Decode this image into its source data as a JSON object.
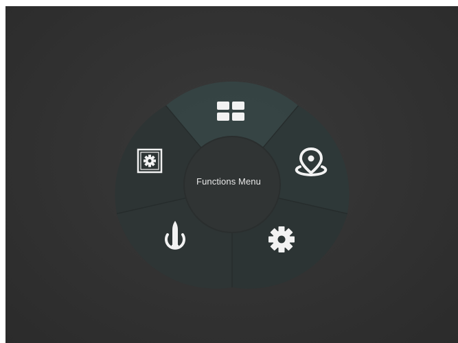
{
  "menu": {
    "center_label": "Functions Menu",
    "items": [
      {
        "id": "dashboard",
        "icon": "grid-icon",
        "selected": true
      },
      {
        "id": "location",
        "icon": "location-pin-icon",
        "selected": false
      },
      {
        "id": "settings",
        "icon": "gear-icon",
        "selected": false
      },
      {
        "id": "ammo-power",
        "icon": "bullet-power-icon",
        "selected": false
      },
      {
        "id": "box-settings",
        "icon": "boxed-gear-icon",
        "selected": false
      }
    ]
  },
  "colors": {
    "background": "#2f2f2f",
    "ring": "#2c3434",
    "selected_segment": "#364545",
    "icon": "#f2f2f2"
  }
}
